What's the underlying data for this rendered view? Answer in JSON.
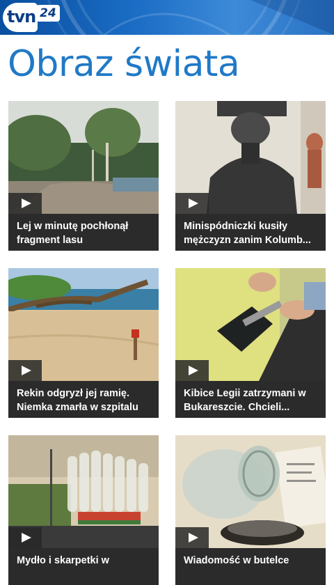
{
  "header": {
    "logo_text": "tvn",
    "logo_number": "24",
    "accent": "#1a6cc4"
  },
  "page": {
    "title": "Obraz świata",
    "title_color": "#2079c7"
  },
  "tiles": [
    {
      "line1": "Lej w minutę pochłonął",
      "line2": "fragment lasu",
      "play_icon": "play-icon"
    },
    {
      "line1": "Minispódniczki kusiły",
      "line2": "mężczyzn zanim Kolumb...",
      "play_icon": "play-icon"
    },
    {
      "line1": "Rekin odgryzł jej ramię.",
      "line2": "Niemka zmarła w szpitalu",
      "play_icon": "play-icon"
    },
    {
      "line1": "Kibice Legii zatrzymani w",
      "line2": "Bukareszcie. Chcieli...",
      "play_icon": "play-icon"
    },
    {
      "line1": "Mydło i skarpetki w",
      "line2": "",
      "play_icon": "play-icon"
    },
    {
      "line1": "Wiadomość w butelce",
      "line2": "",
      "play_icon": "play-icon"
    }
  ]
}
